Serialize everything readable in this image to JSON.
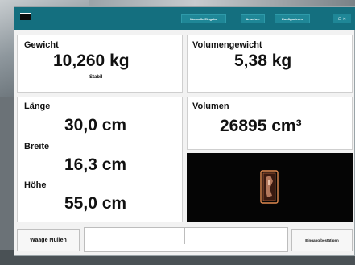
{
  "header": {
    "buttons": [
      "Manuelle Eingabe",
      "Ansehen",
      "Konfigurieren"
    ],
    "close_label": "⊡ ✕"
  },
  "weight": {
    "label": "Gewicht",
    "value": "10,260 kg",
    "status": "Stabil"
  },
  "volume_weight": {
    "label": "Volumengewicht",
    "value": "5,38 kg"
  },
  "dimensions": {
    "length_label": "Länge",
    "length_value": "30,0 cm",
    "width_label": "Breite",
    "width_value": "16,3 cm",
    "height_label": "Höhe",
    "height_value": "55,0 cm"
  },
  "volume": {
    "label": "Volumen",
    "value": "26895 cm³"
  },
  "bottom": {
    "zero_button": "Waage Nullen",
    "field_value": "",
    "confirm_button": "Eingang bestätigen"
  },
  "colors": {
    "header": "#146f7f",
    "camera_bg": "#050505",
    "package_outline": "#e08a50"
  }
}
